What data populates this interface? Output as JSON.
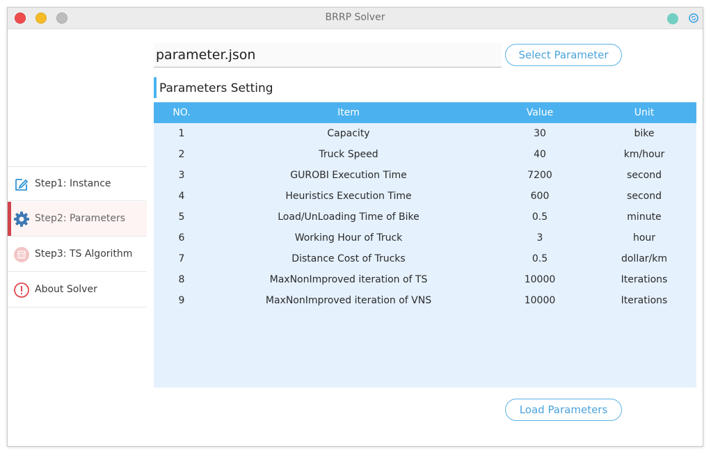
{
  "window": {
    "title": "BRRP Solver"
  },
  "sidebar": {
    "items": [
      {
        "label": "Step1: Instance",
        "icon": "edit-icon"
      },
      {
        "label": "Step2: Parameters",
        "icon": "gear-icon",
        "active": true
      },
      {
        "label": "Step3: TS Algorithm",
        "icon": "calendar-icon"
      },
      {
        "label": "About Solver",
        "icon": "alert-circle-icon"
      }
    ]
  },
  "file": {
    "value": "parameter.json"
  },
  "buttons": {
    "select": "Select Parameter",
    "load": "Load Parameters"
  },
  "section": {
    "title": "Parameters Setting"
  },
  "table": {
    "headers": [
      "NO.",
      "Item",
      "Value",
      "Unit"
    ],
    "rows": [
      [
        "1",
        "Capacity",
        "30",
        "bike"
      ],
      [
        "2",
        "Truck Speed",
        "40",
        "km/hour"
      ],
      [
        "3",
        "GUROBI Execution Time",
        "7200",
        "second"
      ],
      [
        "4",
        "Heuristics Execution Time",
        "600",
        "second"
      ],
      [
        "5",
        "Load/UnLoading Time of Bike",
        "0.5",
        "minute"
      ],
      [
        "6",
        "Working Hour of Truck",
        "3",
        "hour"
      ],
      [
        "7",
        "Distance Cost of Trucks",
        "0.5",
        "dollar/km"
      ],
      [
        "8",
        "MaxNonImproved iteration of TS",
        "10000",
        "Iterations"
      ],
      [
        "9",
        "MaxNonImproved iteration of VNS",
        "10000",
        "Iterations"
      ]
    ]
  },
  "colors": {
    "accent": "#4bb2ef",
    "table_bg": "#e5f1fd",
    "active_marker": "#d2444c",
    "close": "#ef4d4d",
    "minimize": "#f6bb26",
    "maximize": "#bcbcbc"
  }
}
